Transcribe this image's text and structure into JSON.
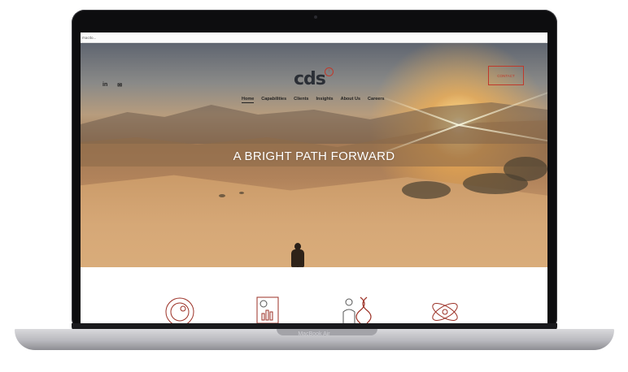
{
  "device": {
    "brand_label": "MacBook Air"
  },
  "browser": {
    "url_text": "macdo..."
  },
  "site": {
    "logo_text": "cds",
    "logo_mark": "↑",
    "social": [
      {
        "label": "in",
        "icon": "linkedin-icon"
      },
      {
        "label": "✉",
        "icon": "mail-icon"
      }
    ],
    "nav": [
      "Home",
      "Capabilities",
      "Clients",
      "Insights",
      "About Us",
      "Careers"
    ],
    "active_nav": "Home",
    "contact_label": "CONTACT",
    "headline": "A BRIGHT PATH FORWARD",
    "feature_icons": [
      "360-icon",
      "report-chart-icon",
      "person-dna-icon",
      "atom-icon"
    ],
    "accent_color": "#c0392b"
  }
}
